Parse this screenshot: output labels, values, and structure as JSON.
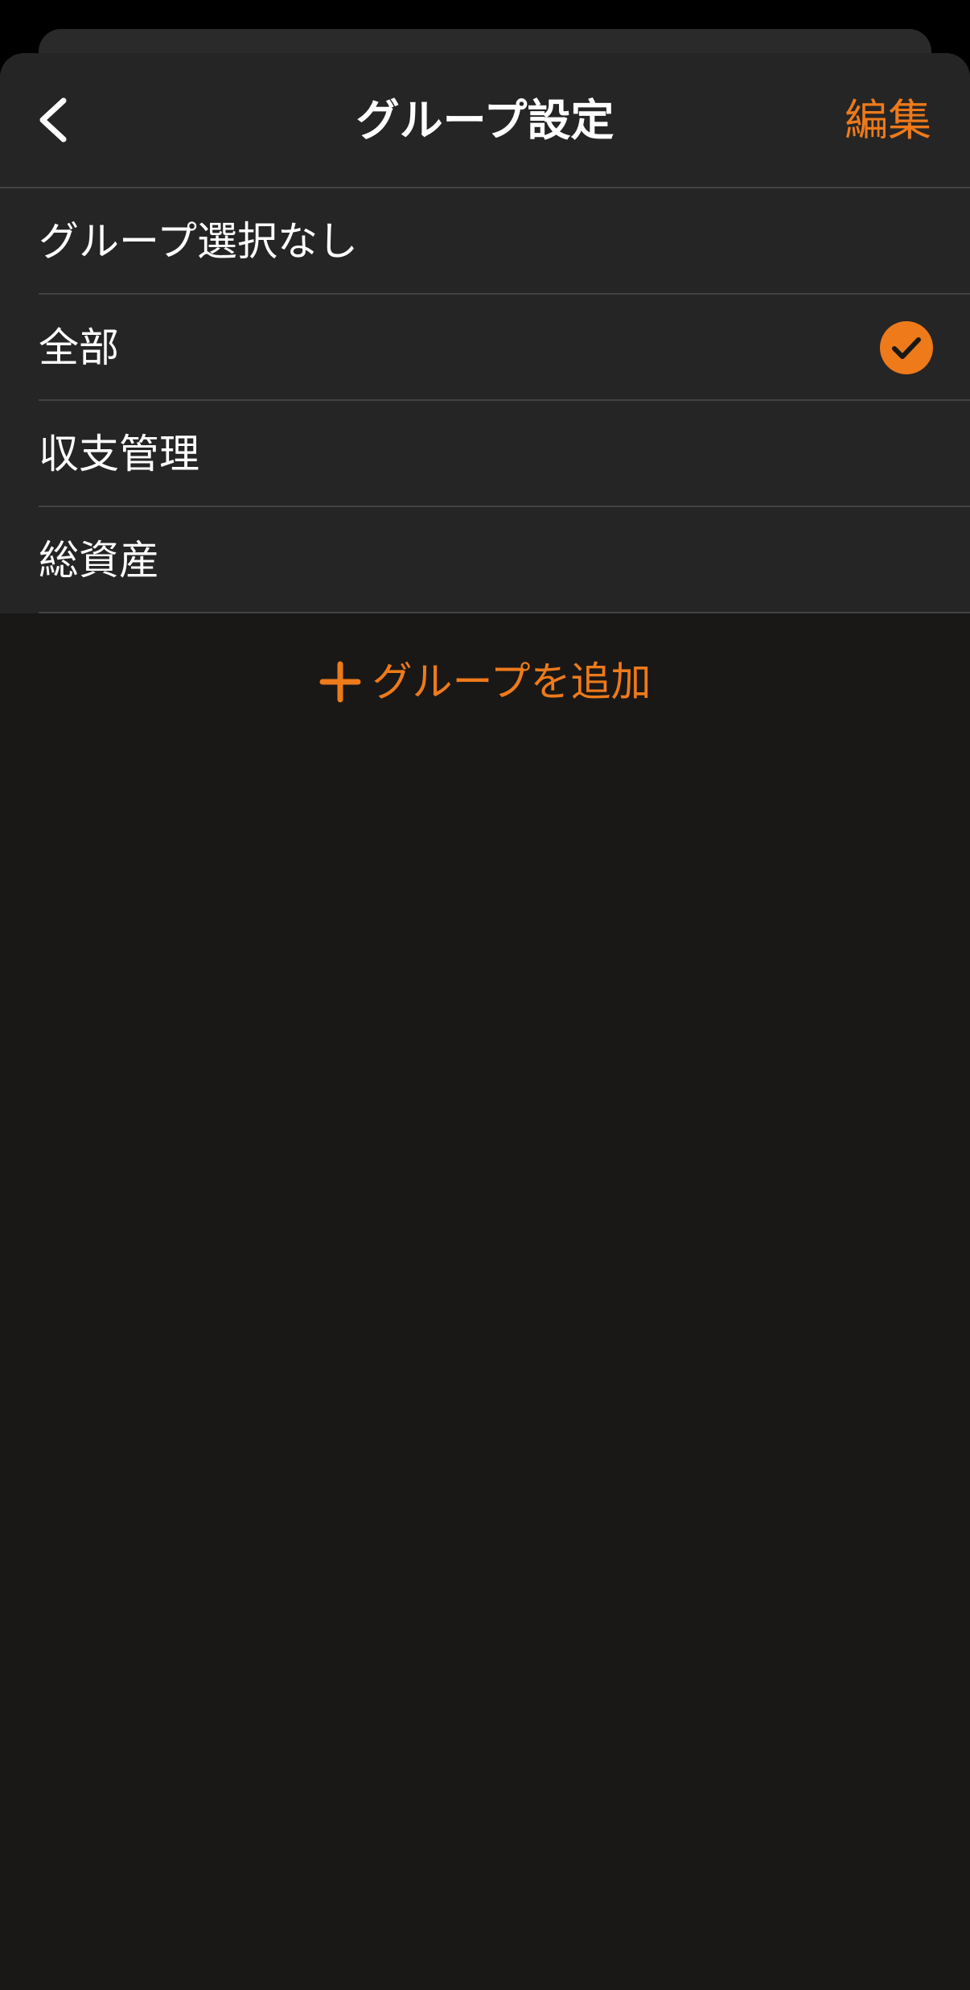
{
  "colors": {
    "accent": "#ee7a1a",
    "background": "#191817",
    "surface": "#252525",
    "separator": "#424242",
    "text": "#ffffff"
  },
  "nav": {
    "back_icon": "chevron-left-icon",
    "title": "グループ設定",
    "edit_label": "編集"
  },
  "groups": {
    "items": [
      {
        "label": "グループ選択なし",
        "selected": false
      },
      {
        "label": "全部",
        "selected": true
      },
      {
        "label": "収支管理",
        "selected": false
      },
      {
        "label": "総資産",
        "selected": false
      }
    ],
    "selected_icon": "checkmark-circle-icon"
  },
  "add_group": {
    "icon": "plus-icon",
    "label": "グループを追加"
  }
}
